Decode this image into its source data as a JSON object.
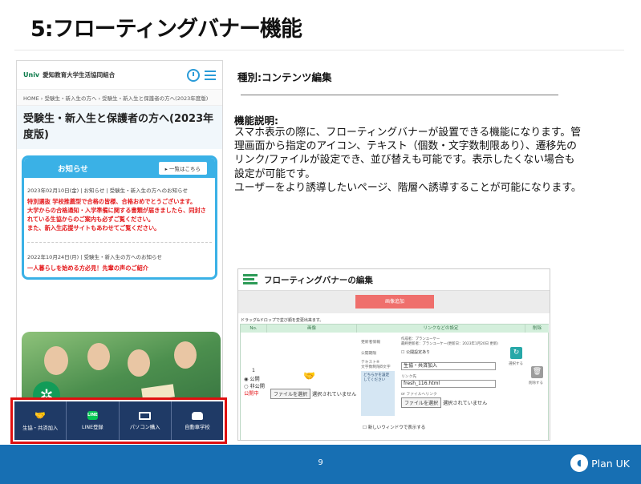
{
  "slide": {
    "title": "5:フローティングバナー機能",
    "page_number": "9",
    "brand": "Plan UK",
    "accent": "#176fb3"
  },
  "phone": {
    "logo_text": "Univ",
    "org_name": "愛知教育大学生活協同組合",
    "clock_label": "営業時間",
    "breadcrumb": "HOME  ›  受験生・新入生の方へ  ›  受験生・新入生と保護者の方へ(2023年度版)",
    "page_title": "受験生・新入生と保護者の方へ(2023年度版)",
    "news": {
      "title": "お知らせ",
      "list_button": "▸ 一覧はこちら",
      "items": [
        {
          "meta": "2023年02月10日(金) | お知らせ | 受験生・新入生の方へのお知らせ",
          "lines": [
            "特別選抜 学校推薦型で合格の皆様、合格おめでとうございます。",
            "大学からの合格通知・入学準備に関する書類が届きましたら、同封されている生協からのご案内も必ずご覧ください。",
            "また、新入生応援サイトもあわせてご覧ください。"
          ]
        },
        {
          "meta": "2022年10月24日(月) | 受験生・新入生の方へのお知らせ",
          "lines": [
            "一人暮らしを始める方必見！先輩の声のご紹介"
          ]
        }
      ]
    },
    "floating_banner": {
      "highlight_color": "#e01010",
      "items": [
        {
          "label": "生協・共済加入",
          "icon": "handshake-icon"
        },
        {
          "label": "LINE登録",
          "icon": "line-icon"
        },
        {
          "label": "パソコン購入",
          "icon": "laptop-icon"
        },
        {
          "label": "自動車学校",
          "icon": "car-icon"
        }
      ]
    }
  },
  "category": {
    "label": "種別:コンテンツ編集"
  },
  "description": {
    "heading": "機能説明:",
    "body": "スマホ表示の際に、フローティングバナーが設置できる機能になります。管理画面から指定のアイコン、テキスト（個数・文字数制限あり）、遷移先のリンク/ファイルが設定でき、並び替えも可能です。表示したくない場合も設定が可能です。",
    "body2": "ユーザーをより誘導したいページ、階層へ誘導することが可能になります。"
  },
  "admin": {
    "title": "フローティングバナーの編集",
    "add_button": "画像追加",
    "drag_note": "ドラッグ&ドロップで並び順を変更出来ます。",
    "columns": [
      "No.",
      "画像",
      "リンクなどの設定",
      "削除"
    ],
    "row": {
      "number": "1",
      "publish": "公開",
      "unpublish": "非公開",
      "status": "公開中",
      "file_button": "ファイルを選択",
      "no_file": "選択されていません",
      "updater_label": "更新者情報",
      "updater_value": "作成者：プランユーケー",
      "updater_value2": "最終更新者：プランユーケー(更新日：2023年1月20日 更新)",
      "period_label": "公開期限",
      "period_value": "公開設定あり",
      "text_label": "テキスト※",
      "text_sublabel": "文字数制限8文字",
      "text_value": "生協・共済加入",
      "link_label": "リンク先",
      "link_value": "fresh_116.html",
      "or_file": "or ファイルへリンク",
      "preview": "どちらかを設定してください",
      "new_window": "新しいウィンドウで表示する",
      "select_label": "選択する",
      "delete_label": "削除する"
    }
  }
}
